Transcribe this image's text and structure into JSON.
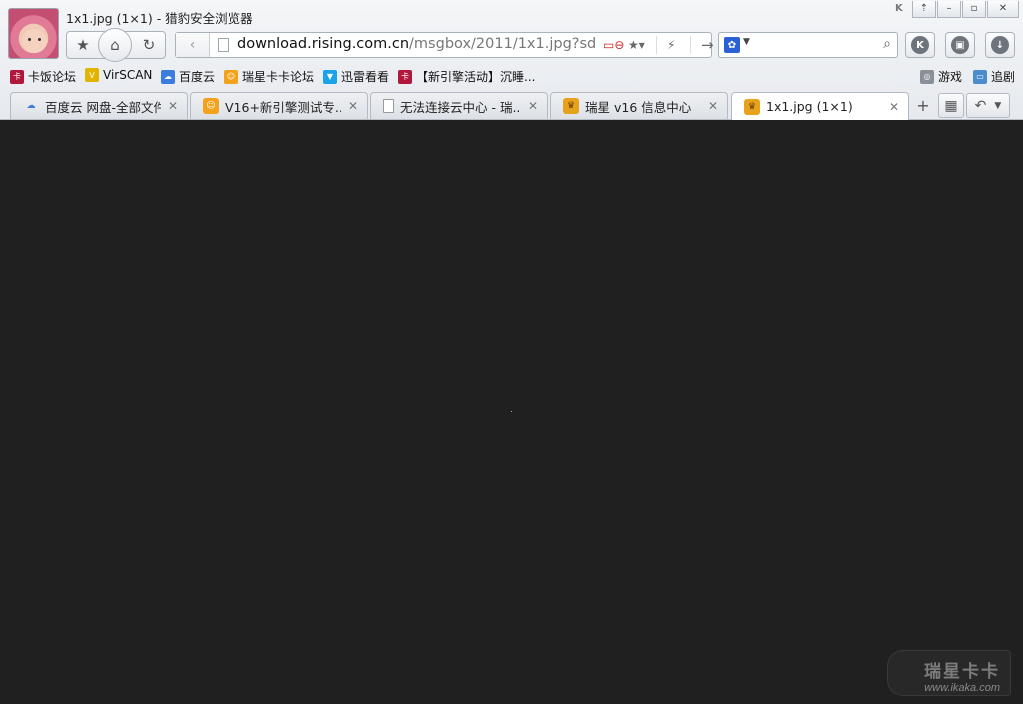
{
  "window": {
    "title": "1x1.jpg (1×1) - 猎豹安全浏览器",
    "controls": [
      "⇡",
      "–",
      "▫",
      "✕"
    ]
  },
  "nav": {
    "address_domain": "download.rising.com.cn",
    "address_path": "/msgbox/2011/1x1.jpg?sd",
    "search_value": ""
  },
  "bookmarks": [
    {
      "label": "卡饭论坛",
      "icon": "kafan-icon",
      "color": "#b0173b"
    },
    {
      "label": "VirSCAN",
      "icon": "virscan-icon",
      "color": "#e2b400"
    },
    {
      "label": "百度云",
      "icon": "baidu-cloud-icon",
      "color": "#3b7ddd"
    },
    {
      "label": "瑞星卡卡论坛",
      "icon": "rising-icon",
      "color": "#f3a21c"
    },
    {
      "label": "迅雷看看",
      "icon": "xunlei-icon",
      "color": "#1aa3e8"
    },
    {
      "label": "【新引擎活动】沉睡...",
      "icon": "kafan-icon",
      "color": "#b0173b"
    }
  ],
  "bookmarks_right": [
    {
      "label": "游戏",
      "icon": "gamepad-icon"
    },
    {
      "label": "追剧",
      "icon": "tv-icon"
    }
  ],
  "tabs": [
    {
      "label": "百度云 网盘-全部文件",
      "icon": "baidu-cloud-icon",
      "active": false
    },
    {
      "label": "V16+新引擎测试专...",
      "icon": "rising-icon",
      "active": false
    },
    {
      "label": "无法连接云中心 - 瑞...",
      "icon": "page-icon",
      "active": false
    },
    {
      "label": "瑞星 v16 信息中心",
      "icon": "lion-icon",
      "active": false
    },
    {
      "label": "1x1.jpg (1×1)",
      "icon": "lion-icon",
      "active": true
    }
  ],
  "watermark": {
    "line1": "瑞星卡卡",
    "line2": "www.ikaka.com"
  }
}
